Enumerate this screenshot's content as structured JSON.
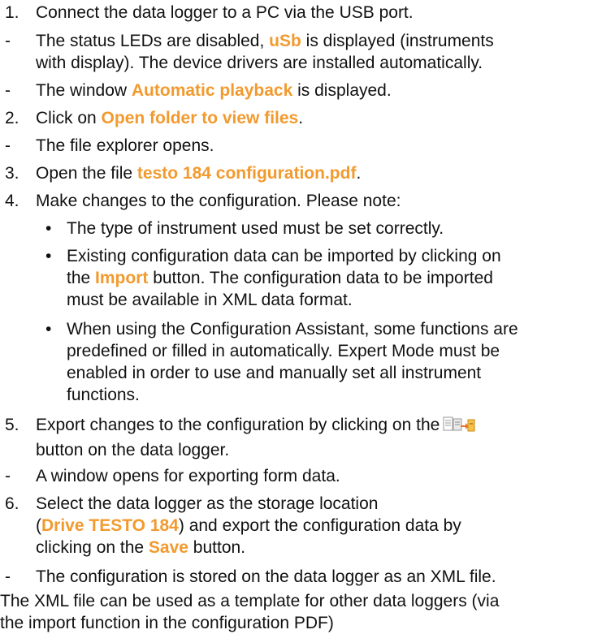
{
  "steps": [
    {
      "marker": "1.",
      "text": "Connect the data logger to a PC via the USB port."
    },
    {
      "marker": "-",
      "pre": "The status LEDs are disabled, ",
      "hl": "uSb",
      "post": " is displayed (instruments",
      "line2": "with display). The device drivers are installed automatically."
    },
    {
      "marker": "-",
      "pre": "The window ",
      "hl": "Automatic playback",
      "post": " is displayed."
    },
    {
      "marker": "2.",
      "pre": "Click on ",
      "hl": "Open folder to view files",
      "post": "."
    },
    {
      "marker": "-",
      "text": "The file explorer opens."
    },
    {
      "marker": "3.",
      "pre": "Open the file ",
      "hl": "testo 184 configuration.pdf",
      "post": "."
    },
    {
      "marker": "4.",
      "text": "Make changes to the configuration. Please note:"
    },
    {
      "marker": "5.",
      "pre": "Export changes to the configuration by clicking on the",
      "line2": "button on the data logger."
    },
    {
      "marker": "-",
      "text": "A window opens for exporting form data."
    },
    {
      "marker": "6.",
      "text": "Select the data logger as the storage location",
      "l2_pre": "(",
      "l2_hl": "Drive TESTO 184",
      "l2_post": ") and export the configuration data by",
      "l3_pre": "clicking on the ",
      "l3_hl": "Save",
      "l3_post": " button."
    },
    {
      "marker": "-",
      "text": "The configuration is stored on the data logger as an XML file."
    }
  ],
  "notes": [
    {
      "bullet": "•",
      "text": "The type of instrument used must be set correctly."
    },
    {
      "bullet": "•",
      "text": "Existing configuration data can be imported by clicking on",
      "l2_pre": "the ",
      "l2_hl": "Import",
      "l2_post": " button. The configuration data to be imported",
      "l3": "must be available in XML data format."
    },
    {
      "bullet": "•",
      "text": "When using the Configuration Assistant, some functions are",
      "l2": "predefined or filled in automatically. Expert Mode must be",
      "l3": "enabled in order to use and manually set all instrument",
      "l4": "functions."
    }
  ],
  "footer": {
    "line1": "The XML file can be used as a template for other data loggers (via",
    "line2": "the import function in the configuration PDF)"
  },
  "colors": {
    "highlight": "#f29a2e",
    "text": "#111111"
  },
  "icons": {
    "export_button": "export-form-data-icon"
  }
}
